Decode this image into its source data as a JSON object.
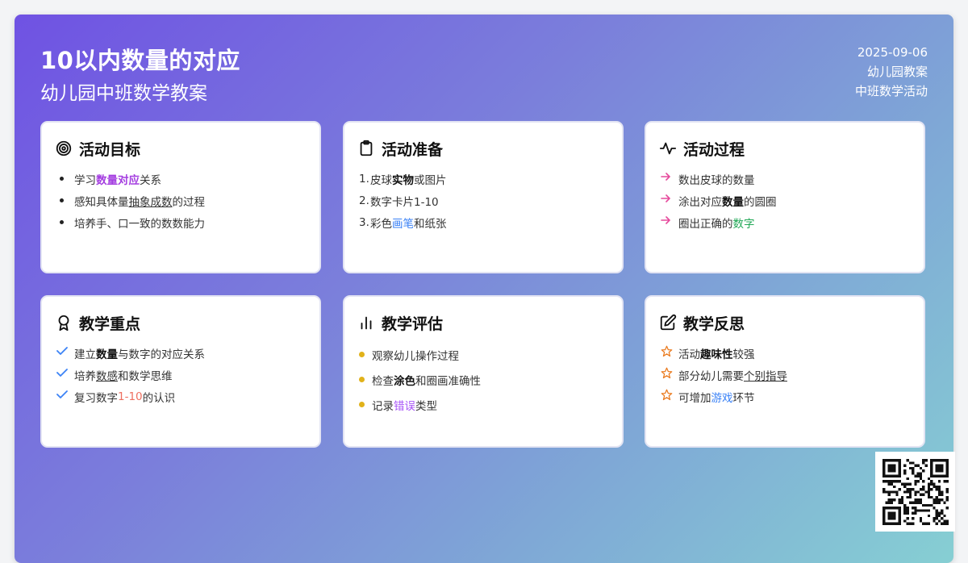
{
  "header": {
    "title": "10以内数量的对应",
    "subtitle": "幼儿园中班数学教案",
    "date": "2025-09-06",
    "category": "幼儿园教案",
    "activity": "中班数学活动"
  },
  "cards": {
    "goals": {
      "title": "活动目标",
      "icon": "target-icon",
      "items": [
        {
          "a": "学习",
          "b": "数量对应",
          "c": "关系"
        },
        {
          "a": "感知具体量",
          "b": "抽象成数",
          "c": "的过程"
        },
        {
          "a": "培养手、口一致的数数能力"
        }
      ]
    },
    "prep": {
      "title": "活动准备",
      "icon": "clipboard-icon",
      "items": [
        {
          "n": "1.",
          "a": "皮球",
          "b": "实物",
          "c": "或图片"
        },
        {
          "n": "2.",
          "a": "数字卡片1-10"
        },
        {
          "n": "3.",
          "a": "彩色",
          "b": "画笔",
          "c": "和纸张"
        }
      ]
    },
    "process": {
      "title": "活动过程",
      "icon": "activity-pulse-icon",
      "items": [
        {
          "a": "数出皮球的数量"
        },
        {
          "a": "涂出对应",
          "b": "数量",
          "c": "的圆圈"
        },
        {
          "a": "圈出正确的",
          "b": "数字"
        }
      ]
    },
    "focus": {
      "title": "教学重点",
      "icon": "award-ribbon-icon",
      "items": [
        {
          "a": "建立",
          "b": "数量",
          "c": "与数字的对应关系"
        },
        {
          "a": "培养",
          "b": "数感",
          "c": "和数学思维"
        },
        {
          "a": "复习数字",
          "b": "1-10",
          "c": "的认识"
        }
      ]
    },
    "eval": {
      "title": "教学评估",
      "icon": "bar-chart-icon",
      "items": [
        {
          "a": "观察幼儿操作过程"
        },
        {
          "a": "检查",
          "b": "涂色",
          "c": "和圈画准确性"
        },
        {
          "a": "记录",
          "b": "错误",
          "c": "类型"
        }
      ]
    },
    "reflect": {
      "title": "教学反思",
      "icon": "edit-icon",
      "items": [
        {
          "a": "活动",
          "b": "趣味性",
          "c": "较强"
        },
        {
          "a": "部分幼儿需要",
          "b": "个别指导"
        },
        {
          "a": "可增加",
          "b": "游戏",
          "c": "环节"
        }
      ]
    }
  },
  "colors": {
    "gradient_start": "#6f52e3",
    "gradient_end": "#86cfd3",
    "accent_purple": "#a43ee0",
    "accent_pink": "#e64a9c",
    "accent_blue": "#3b82f6",
    "accent_green": "#22a857",
    "accent_yellow": "#e1b21a",
    "accent_orange": "#ea7a1e"
  },
  "qr_code": {
    "icon": "qr-code-icon"
  }
}
